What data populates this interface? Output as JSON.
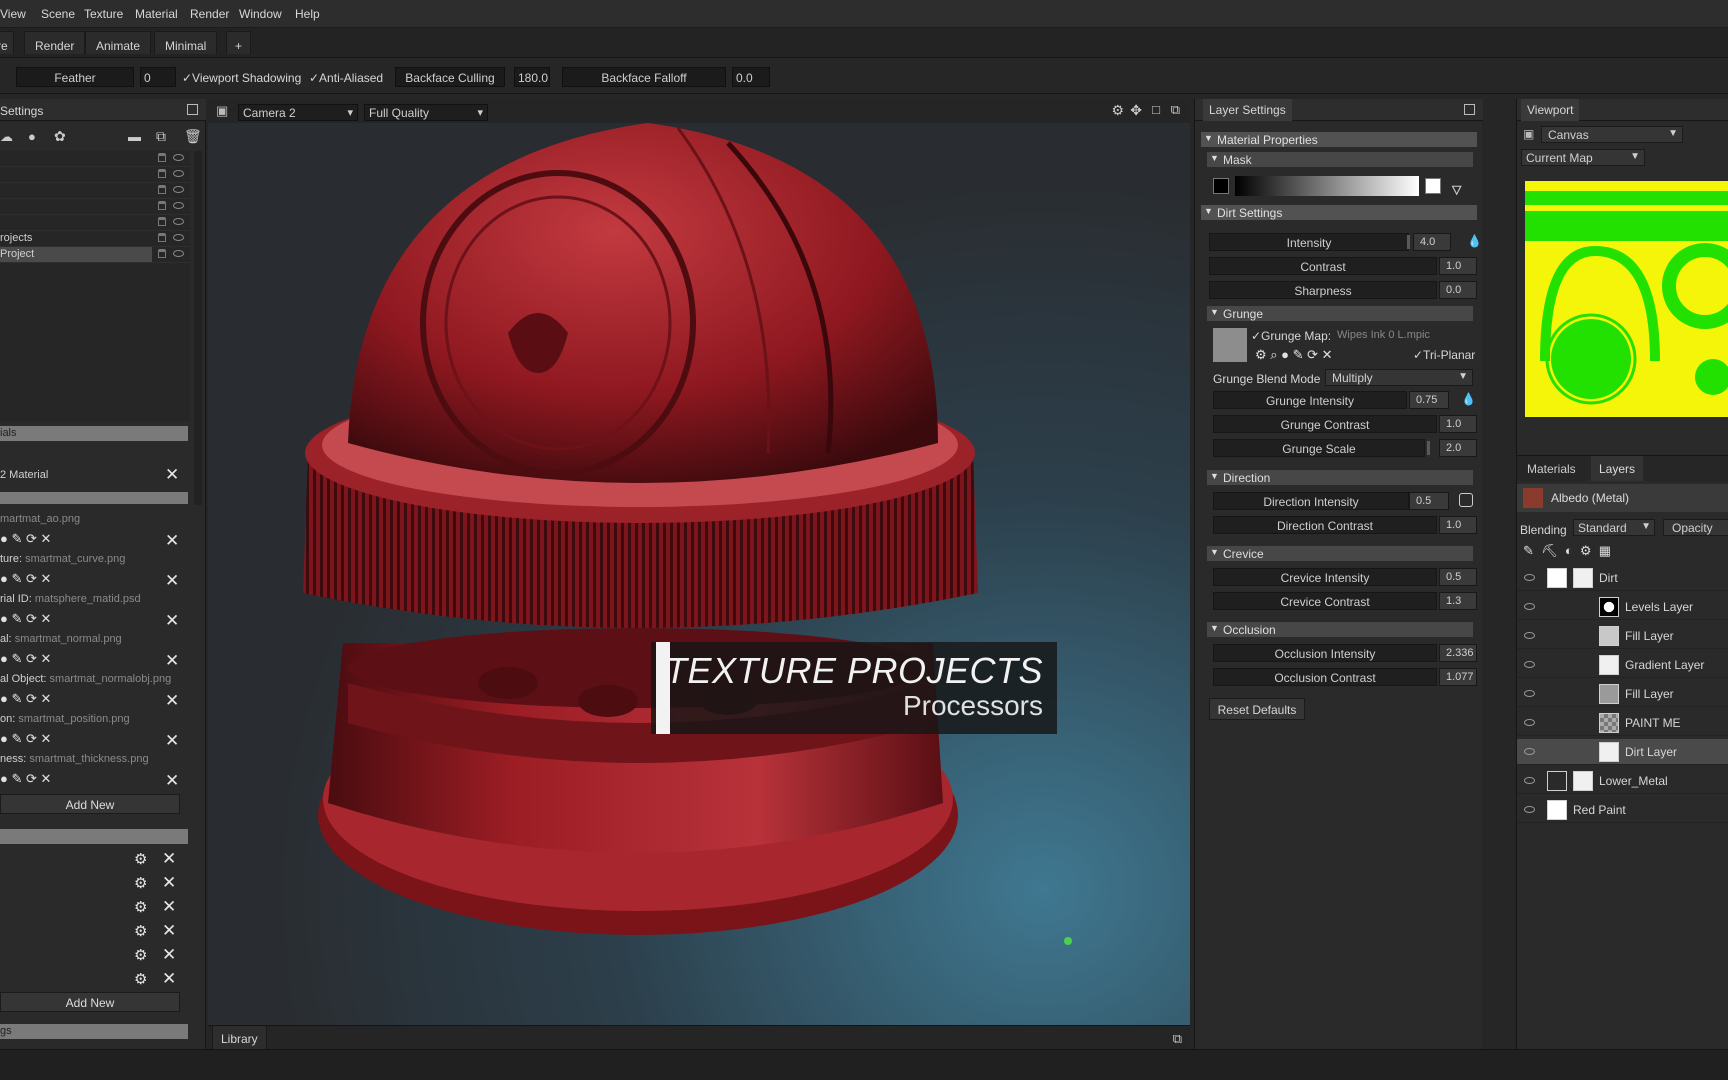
{
  "menu": [
    "View",
    "Scene",
    "Texture",
    "Material",
    "Render",
    "Window",
    "Help"
  ],
  "workspace_tabs": [
    "re",
    "Render",
    "Animate",
    "Minimal",
    "+"
  ],
  "toolbar": {
    "feather_label": "Feather",
    "feather_value": "0",
    "viewport_shadowing": "✓Viewport Shadowing",
    "anti_aliased": "✓Anti-Aliased",
    "backface_culling": "Backface Culling",
    "backface_culling_value": "180.0",
    "backface_falloff": "Backface Falloff",
    "backface_falloff_value": "0.0"
  },
  "left": {
    "header": "Settings",
    "project_rows": [
      "",
      "",
      "",
      "",
      "",
      "rojects",
      "Project"
    ],
    "materials_header": "ials",
    "material_name": "2 Material",
    "maps": [
      {
        "label": "",
        "file": "martmat_ao.png"
      },
      {
        "label": "ture:",
        "file": "smartmat_curve.png"
      },
      {
        "label": "rial ID:",
        "file": "matsphere_matid.psd"
      },
      {
        "label": "al:",
        "file": "smartmat_normal.png"
      },
      {
        "label": "al Object:",
        "file": "smartmat_normalobj.png"
      },
      {
        "label": "on:",
        "file": "smartmat_position.png"
      },
      {
        "label": "ness:",
        "file": "smartmat_thickness.png"
      }
    ],
    "add_new_1": "Add New",
    "add_new_2": "Add New",
    "bottom_header": "gs"
  },
  "viewport": {
    "camera": "Camera 2",
    "quality": "Full Quality",
    "banner_title": "TEXTURE PROJECTS",
    "banner_sub": "Processors",
    "library_tab": "Library"
  },
  "layer_settings": {
    "tab": "Layer Settings",
    "material_properties": "Material Properties",
    "mask": "Mask",
    "dirt_settings": "Dirt Settings",
    "intensity_label": "Intensity",
    "intensity_value": "4.0",
    "contrast_label": "Contrast",
    "contrast_value": "1.0",
    "sharpness_label": "Sharpness",
    "sharpness_value": "0.0",
    "grunge": "Grunge",
    "grunge_map_label": "✓Grunge Map:",
    "grunge_map_file": "Wipes Ink 0 L.mpic",
    "tri_planar": "✓Tri-Planar",
    "grunge_blend_label": "Grunge Blend Mode",
    "grunge_blend_value": "Multiply",
    "grunge_intensity_label": "Grunge Intensity",
    "grunge_intensity_value": "0.75",
    "grunge_contrast_label": "Grunge Contrast",
    "grunge_contrast_value": "1.0",
    "grunge_scale_label": "Grunge Scale",
    "grunge_scale_value": "2.0",
    "direction": "Direction",
    "direction_intensity_label": "Direction Intensity",
    "direction_intensity_value": "0.5",
    "direction_contrast_label": "Direction Contrast",
    "direction_contrast_value": "1.0",
    "crevice": "Crevice",
    "crevice_intensity_label": "Crevice Intensity",
    "crevice_intensity_value": "0.5",
    "crevice_contrast_label": "Crevice Contrast",
    "crevice_contrast_value": "1.3",
    "occlusion": "Occlusion",
    "occlusion_intensity_label": "Occlusion Intensity",
    "occlusion_intensity_value": "2.336",
    "occlusion_contrast_label": "Occlusion Contrast",
    "occlusion_contrast_value": "1.077",
    "reset_defaults": "Reset Defaults"
  },
  "right": {
    "viewport_tab": "Viewport",
    "canvas": "Canvas",
    "current_map": "Current Map",
    "materials_tab": "Materials",
    "layers_tab": "Layers",
    "albedo": "Albedo (Metal)",
    "blending_label": "Blending",
    "blending_value": "Standard",
    "opacity_label": "Opacity",
    "layers": [
      {
        "name": "Dirt",
        "type": "folder"
      },
      {
        "name": "Levels Layer",
        "type": "child"
      },
      {
        "name": "Fill Layer",
        "type": "child"
      },
      {
        "name": "Gradient Layer",
        "type": "child"
      },
      {
        "name": "Fill Layer",
        "type": "child"
      },
      {
        "name": "PAINT ME",
        "type": "child"
      },
      {
        "name": "Dirt Layer",
        "type": "child",
        "selected": true
      },
      {
        "name": "Lower_Metal",
        "type": "folder"
      },
      {
        "name": "Red Paint",
        "type": "folder"
      }
    ]
  },
  "colors": {
    "accent_red": "#a3141c",
    "map_yellow": "#f5f50a",
    "map_green": "#22e000"
  }
}
